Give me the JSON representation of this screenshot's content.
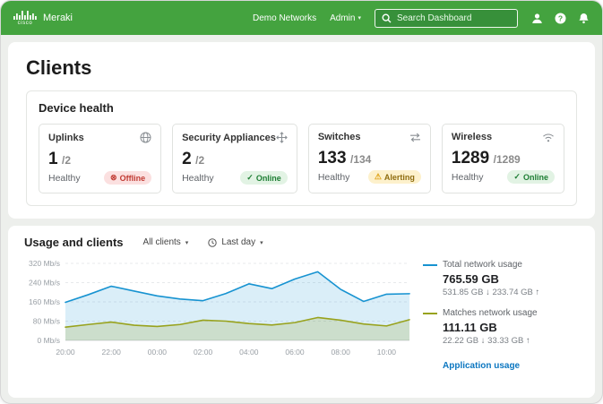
{
  "ui": {
    "icons": {
      "caret": "▾",
      "down_arrow": "↓",
      "up_arrow": "↑"
    }
  },
  "header": {
    "brand": {
      "cisco": "cisco",
      "product": "Meraki"
    },
    "nav": {
      "network_label": "Demo Networks",
      "admin_label": "Admin"
    },
    "search": {
      "placeholder": "Search Dashboard"
    }
  },
  "page": {
    "title": "Clients"
  },
  "device_health": {
    "title": "Device health",
    "cards": [
      {
        "label": "Uplinks",
        "icon": "globe",
        "count": "1",
        "total": "/2",
        "sub": "Healthy",
        "badge": {
          "icon": "⊗",
          "text": "Offline",
          "status": "offline"
        }
      },
      {
        "label": "Security Appliances",
        "icon": "appliance",
        "count": "2",
        "total": "/2",
        "sub": "Healthy",
        "badge": {
          "icon": "✓",
          "text": "Online",
          "status": "online"
        }
      },
      {
        "label": "Switches",
        "icon": "switch-arrows",
        "count": "133",
        "total": "/134",
        "sub": "Healthy",
        "badge": {
          "icon": "⚠",
          "text": "Alerting",
          "status": "alerting"
        }
      },
      {
        "label": "Wireless",
        "icon": "wifi",
        "count": "1289",
        "total": "/1289",
        "sub": "Healthy",
        "badge": {
          "icon": "✓",
          "text": "Online",
          "status": "online"
        }
      }
    ]
  },
  "usage": {
    "title": "Usage and clients",
    "filters": [
      {
        "label": "All clients"
      },
      {
        "label": "Last day"
      }
    ],
    "legend": [
      {
        "name": "Total network usage",
        "value": "765.59 GB",
        "down": "531.85 GB",
        "up": "233.74 GB"
      },
      {
        "name": "Matches network usage",
        "value": "111.11 GB",
        "down": "22.22 GB",
        "up": "33.33 GB"
      }
    ],
    "link": "Application usage"
  },
  "chart_data": {
    "type": "area",
    "title": "Usage and clients",
    "x_labels": [
      "20:00",
      "",
      "22:00",
      "",
      "00:00",
      "",
      "02:00",
      "",
      "04:00",
      "",
      "06:00",
      "",
      "08:00",
      "",
      "10:00",
      ""
    ],
    "y_ticks": [
      0,
      80,
      160,
      240,
      320
    ],
    "y_unit": "Mb/s",
    "ylim": [
      0,
      320
    ],
    "grid": true,
    "legend_position": "right",
    "series": [
      {
        "name": "Total network usage",
        "color": "#1793d1",
        "fill": "rgba(23,147,209,0.16)",
        "values": [
          158,
          190,
          225,
          205,
          185,
          172,
          165,
          195,
          235,
          215,
          255,
          285,
          212,
          162,
          192,
          194
        ]
      },
      {
        "name": "Matches network usage",
        "color": "#98a21d",
        "fill": "rgba(152,162,29,0.20)",
        "values": [
          55,
          66,
          76,
          63,
          58,
          66,
          84,
          80,
          70,
          64,
          74,
          95,
          84,
          68,
          60,
          86
        ]
      }
    ]
  }
}
